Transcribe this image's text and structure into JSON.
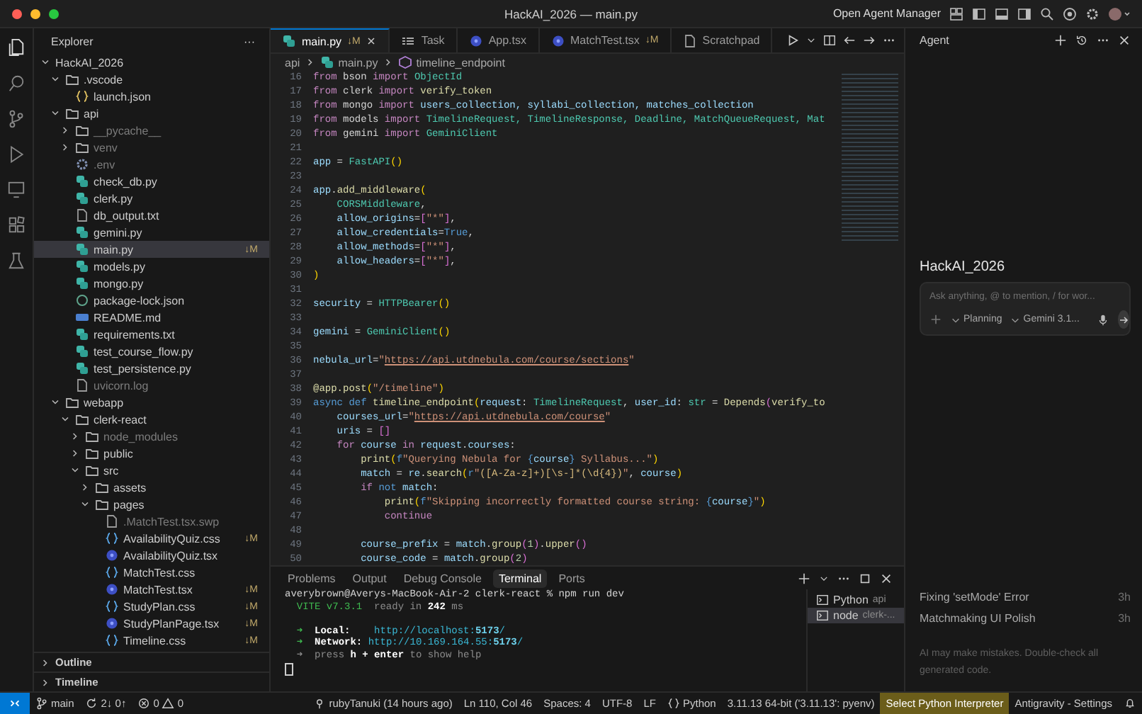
{
  "window": {
    "title": "HackAI_2026 — main.py",
    "agent_manager": "Open Agent Manager"
  },
  "explorer": {
    "title": "Explorer",
    "more": "···",
    "tree": [
      {
        "name": "HackAI_2026",
        "kind": "root",
        "expanded": true,
        "selected": false,
        "dimmed": false,
        "children": [
          {
            "name": ".vscode",
            "kind": "folder",
            "expanded": true,
            "selected": false,
            "dimmed": false,
            "children": [
              {
                "name": "launch.json",
                "kind": "json",
                "selected": false,
                "dimmed": false
              }
            ]
          },
          {
            "name": "api",
            "kind": "folder",
            "expanded": true,
            "selected": false,
            "dimmed": false,
            "children": [
              {
                "name": "__pycache__",
                "kind": "folder",
                "expanded": false,
                "selected": false,
                "dimmed": true
              },
              {
                "name": "venv",
                "kind": "folder",
                "expanded": false,
                "selected": false,
                "dimmed": true
              },
              {
                "name": ".env",
                "kind": "env",
                "selected": false,
                "dimmed": true
              },
              {
                "name": "check_db.py",
                "kind": "py",
                "selected": false,
                "dimmed": false
              },
              {
                "name": "clerk.py",
                "kind": "py",
                "selected": false,
                "dimmed": false
              },
              {
                "name": "db_output.txt",
                "kind": "txt",
                "selected": false,
                "dimmed": false
              },
              {
                "name": "gemini.py",
                "kind": "py",
                "selected": false,
                "dimmed": false
              },
              {
                "name": "main.py",
                "kind": "py",
                "selected": true,
                "dimmed": false,
                "badge": "↓M"
              },
              {
                "name": "models.py",
                "kind": "py",
                "selected": false,
                "dimmed": false
              },
              {
                "name": "mongo.py",
                "kind": "py",
                "selected": false,
                "dimmed": false
              },
              {
                "name": "package-lock.json",
                "kind": "npm",
                "selected": false,
                "dimmed": false
              },
              {
                "name": "README.md",
                "kind": "md",
                "selected": false,
                "dimmed": false
              },
              {
                "name": "requirements.txt",
                "kind": "py",
                "selected": false,
                "dimmed": false
              },
              {
                "name": "test_course_flow.py",
                "kind": "py",
                "selected": false,
                "dimmed": false
              },
              {
                "name": "test_persistence.py",
                "kind": "py",
                "selected": false,
                "dimmed": false
              },
              {
                "name": "uvicorn.log",
                "kind": "txt",
                "selected": false,
                "dimmed": true
              }
            ]
          },
          {
            "name": "webapp",
            "kind": "folder",
            "expanded": true,
            "selected": false,
            "dimmed": false,
            "children": [
              {
                "name": "clerk-react",
                "kind": "folder",
                "expanded": true,
                "selected": false,
                "dimmed": false,
                "children": [
                  {
                    "name": "node_modules",
                    "kind": "folder",
                    "expanded": false,
                    "selected": false,
                    "dimmed": true
                  },
                  {
                    "name": "public",
                    "kind": "folder",
                    "expanded": false,
                    "selected": false,
                    "dimmed": false
                  },
                  {
                    "name": "src",
                    "kind": "folder",
                    "expanded": true,
                    "selected": false,
                    "dimmed": false,
                    "children": [
                      {
                        "name": "assets",
                        "kind": "folder",
                        "expanded": false,
                        "selected": false,
                        "dimmed": false
                      },
                      {
                        "name": "pages",
                        "kind": "folder",
                        "expanded": true,
                        "selected": false,
                        "dimmed": false,
                        "children": [
                          {
                            "name": ".MatchTest.tsx.swp",
                            "kind": "txt",
                            "selected": false,
                            "dimmed": true
                          },
                          {
                            "name": "AvailabilityQuiz.css",
                            "kind": "css",
                            "selected": false,
                            "dimmed": false,
                            "badge": "↓M"
                          },
                          {
                            "name": "AvailabilityQuiz.tsx",
                            "kind": "react",
                            "selected": false,
                            "dimmed": false
                          },
                          {
                            "name": "MatchTest.css",
                            "kind": "css",
                            "selected": false,
                            "dimmed": false
                          },
                          {
                            "name": "MatchTest.tsx",
                            "kind": "react",
                            "selected": false,
                            "dimmed": false,
                            "badge": "↓M"
                          },
                          {
                            "name": "StudyPlan.css",
                            "kind": "css",
                            "selected": false,
                            "dimmed": false,
                            "badge": "↓M"
                          },
                          {
                            "name": "StudyPlanPage.tsx",
                            "kind": "react",
                            "selected": false,
                            "dimmed": false,
                            "badge": "↓M"
                          },
                          {
                            "name": "Timeline.css",
                            "kind": "css",
                            "selected": false,
                            "dimmed": false,
                            "badge": "↓M"
                          }
                        ]
                      }
                    ]
                  }
                ]
              }
            ]
          }
        ]
      }
    ],
    "sections": [
      {
        "label": "Outline",
        "expanded": false
      },
      {
        "label": "Timeline",
        "expanded": false
      }
    ]
  },
  "editor": {
    "tabs": [
      {
        "label": "main.py",
        "kind": "py",
        "selected": true,
        "badge": "↓M"
      },
      {
        "label": "Task",
        "kind": "task",
        "selected": false
      },
      {
        "label": "App.tsx",
        "kind": "react",
        "selected": false
      },
      {
        "label": "MatchTest.tsx",
        "kind": "react",
        "selected": false,
        "badge": "↓M"
      },
      {
        "label": "Scratchpad",
        "kind": "txt",
        "selected": false
      }
    ],
    "breadcrumb": [
      {
        "label": "api",
        "kind": "folder"
      },
      {
        "label": "main.py",
        "kind": "py"
      },
      {
        "label": "timeline_endpoint",
        "kind": "symbol"
      }
    ],
    "lines": [
      {
        "number": "16",
        "tokens": [
          {
            "kind": "kw",
            "text": "from"
          },
          {
            "kind": "pl",
            "text": " bson "
          },
          {
            "kind": "kw",
            "text": "import"
          },
          {
            "kind": "cls",
            "text": " ObjectId"
          }
        ]
      },
      {
        "number": "17",
        "tokens": [
          {
            "kind": "kw",
            "text": "from"
          },
          {
            "kind": "pl",
            "text": " clerk "
          },
          {
            "kind": "kw",
            "text": "import"
          },
          {
            "kind": "fn",
            "text": " verify_token"
          }
        ]
      },
      {
        "number": "18",
        "tokens": [
          {
            "kind": "kw",
            "text": "from"
          },
          {
            "kind": "pl",
            "text": " mongo "
          },
          {
            "kind": "kw",
            "text": "import"
          },
          {
            "kind": "var",
            "text": " users_collection, syllabi_collection, matches_collection"
          }
        ]
      },
      {
        "number": "19",
        "tokens": [
          {
            "kind": "kw",
            "text": "from"
          },
          {
            "kind": "pl",
            "text": " models "
          },
          {
            "kind": "kw",
            "text": "import"
          },
          {
            "kind": "cls",
            "text": " TimelineRequest, TimelineResponse, Deadline, MatchQueueRequest, Mat"
          }
        ]
      },
      {
        "number": "20",
        "tokens": [
          {
            "kind": "kw",
            "text": "from"
          },
          {
            "kind": "pl",
            "text": " gemini "
          },
          {
            "kind": "kw",
            "text": "import"
          },
          {
            "kind": "cls",
            "text": " GeminiClient"
          }
        ]
      },
      {
        "number": "21"
      },
      {
        "number": "22",
        "tokens": [
          {
            "kind": "var",
            "text": "app"
          },
          {
            "kind": "pl",
            "text": " = "
          },
          {
            "kind": "cls",
            "text": "FastAPI"
          },
          {
            "kind": "br",
            "text": "()"
          }
        ]
      },
      {
        "number": "23"
      },
      {
        "number": "24",
        "tokens": [
          {
            "kind": "var",
            "text": "app"
          },
          {
            "kind": "pl",
            "text": "."
          },
          {
            "kind": "fn",
            "text": "add_middleware"
          },
          {
            "kind": "br",
            "text": "("
          }
        ]
      },
      {
        "number": "25",
        "tokens": [
          {
            "kind": "cls",
            "text": "    CORSMiddleware"
          },
          {
            "kind": "pl",
            "text": ","
          }
        ]
      },
      {
        "number": "26",
        "tokens": [
          {
            "kind": "var",
            "text": "    allow_origins"
          },
          {
            "kind": "pl",
            "text": "="
          },
          {
            "kind": "br2",
            "text": "["
          },
          {
            "kind": "str",
            "text": "\"*\""
          },
          {
            "kind": "br2",
            "text": "]"
          },
          {
            "kind": "pl",
            "text": ","
          }
        ]
      },
      {
        "number": "27",
        "tokens": [
          {
            "kind": "var",
            "text": "    allow_credentials"
          },
          {
            "kind": "pl",
            "text": "="
          },
          {
            "kind": "st",
            "text": "True"
          },
          {
            "kind": "pl",
            "text": ","
          }
        ]
      },
      {
        "number": "28",
        "tokens": [
          {
            "kind": "var",
            "text": "    allow_methods"
          },
          {
            "kind": "pl",
            "text": "="
          },
          {
            "kind": "br2",
            "text": "["
          },
          {
            "kind": "str",
            "text": "\"*\""
          },
          {
            "kind": "br2",
            "text": "]"
          },
          {
            "kind": "pl",
            "text": ","
          }
        ]
      },
      {
        "number": "29",
        "tokens": [
          {
            "kind": "var",
            "text": "    allow_headers"
          },
          {
            "kind": "pl",
            "text": "="
          },
          {
            "kind": "br2",
            "text": "["
          },
          {
            "kind": "str",
            "text": "\"*\""
          },
          {
            "kind": "br2",
            "text": "]"
          },
          {
            "kind": "pl",
            "text": ","
          }
        ]
      },
      {
        "number": "30",
        "tokens": [
          {
            "kind": "br",
            "text": ")"
          }
        ]
      },
      {
        "number": "31"
      },
      {
        "number": "32",
        "tokens": [
          {
            "kind": "var",
            "text": "security"
          },
          {
            "kind": "pl",
            "text": " = "
          },
          {
            "kind": "cls",
            "text": "HTTPBearer"
          },
          {
            "kind": "br",
            "text": "()"
          }
        ]
      },
      {
        "number": "33"
      },
      {
        "number": "34",
        "tokens": [
          {
            "kind": "var",
            "text": "gemini"
          },
          {
            "kind": "pl",
            "text": " = "
          },
          {
            "kind": "cls",
            "text": "GeminiClient"
          },
          {
            "kind": "br",
            "text": "()"
          }
        ]
      },
      {
        "number": "35"
      },
      {
        "number": "36",
        "tokens": [
          {
            "kind": "var",
            "text": "nebula_url"
          },
          {
            "kind": "pl",
            "text": "="
          },
          {
            "kind": "str",
            "text": "\""
          },
          {
            "kind": "url",
            "text": "https://api.utdnebula.com/course/sections"
          },
          {
            "kind": "str",
            "text": "\""
          }
        ]
      },
      {
        "number": "37"
      },
      {
        "number": "38",
        "tokens": [
          {
            "kind": "fn",
            "text": "@app.post"
          },
          {
            "kind": "br",
            "text": "("
          },
          {
            "kind": "str",
            "text": "\"/timeline\""
          },
          {
            "kind": "br",
            "text": ")"
          }
        ]
      },
      {
        "number": "39",
        "tokens": [
          {
            "kind": "st",
            "text": "async def "
          },
          {
            "kind": "fn",
            "text": "timeline_endpoint"
          },
          {
            "kind": "br",
            "text": "("
          },
          {
            "kind": "var",
            "text": "request"
          },
          {
            "kind": "pl",
            "text": ": "
          },
          {
            "kind": "cls",
            "text": "TimelineRequest"
          },
          {
            "kind": "pl",
            "text": ", "
          },
          {
            "kind": "var",
            "text": "user_id"
          },
          {
            "kind": "pl",
            "text": ": "
          },
          {
            "kind": "cls",
            "text": "str"
          },
          {
            "kind": "pl",
            "text": " = "
          },
          {
            "kind": "fn",
            "text": "Depends"
          },
          {
            "kind": "br2",
            "text": "("
          },
          {
            "kind": "fn",
            "text": "verify_to"
          }
        ]
      },
      {
        "number": "40",
        "tokens": [
          {
            "kind": "var",
            "text": "    courses_url"
          },
          {
            "kind": "pl",
            "text": "="
          },
          {
            "kind": "str",
            "text": "\""
          },
          {
            "kind": "url",
            "text": "https://api.utdnebula.com/course"
          },
          {
            "kind": "str",
            "text": "\""
          }
        ]
      },
      {
        "number": "41",
        "tokens": [
          {
            "kind": "var",
            "text": "    uris"
          },
          {
            "kind": "pl",
            "text": " = "
          },
          {
            "kind": "br2",
            "text": "[]"
          }
        ]
      },
      {
        "number": "42",
        "tokens": [
          {
            "kind": "kw",
            "text": "    for "
          },
          {
            "kind": "var",
            "text": "course "
          },
          {
            "kind": "kw",
            "text": "in "
          },
          {
            "kind": "var",
            "text": "request"
          },
          {
            "kind": "pl",
            "text": "."
          },
          {
            "kind": "var",
            "text": "courses"
          },
          {
            "kind": "pl",
            "text": ":"
          }
        ]
      },
      {
        "number": "43",
        "tokens": [
          {
            "kind": "fn",
            "text": "        print"
          },
          {
            "kind": "br",
            "text": "("
          },
          {
            "kind": "st",
            "text": "f"
          },
          {
            "kind": "str",
            "text": "\"Querying Nebula for "
          },
          {
            "kind": "st",
            "text": "{"
          },
          {
            "kind": "var",
            "text": "course"
          },
          {
            "kind": "st",
            "text": "}"
          },
          {
            "kind": "str",
            "text": " Syllabus...\""
          },
          {
            "kind": "br",
            "text": ")"
          }
        ]
      },
      {
        "number": "44",
        "tokens": [
          {
            "kind": "var",
            "text": "        match"
          },
          {
            "kind": "pl",
            "text": " = "
          },
          {
            "kind": "var",
            "text": "re"
          },
          {
            "kind": "pl",
            "text": "."
          },
          {
            "kind": "fn",
            "text": "search"
          },
          {
            "kind": "br",
            "text": "("
          },
          {
            "kind": "st",
            "text": "r"
          },
          {
            "kind": "str",
            "text": "\""
          },
          {
            "kind": "esc",
            "text": "([A-Za-z]+)[\\s-]*(\\d{4})"
          },
          {
            "kind": "str",
            "text": "\""
          },
          {
            "kind": "pl",
            "text": ", "
          },
          {
            "kind": "var",
            "text": "course"
          },
          {
            "kind": "br",
            "text": ")"
          }
        ]
      },
      {
        "number": "45",
        "tokens": [
          {
            "kind": "kw",
            "text": "        if "
          },
          {
            "kind": "st",
            "text": "not "
          },
          {
            "kind": "var",
            "text": "match"
          },
          {
            "kind": "pl",
            "text": ":"
          }
        ]
      },
      {
        "number": "46",
        "tokens": [
          {
            "kind": "fn",
            "text": "            print"
          },
          {
            "kind": "br",
            "text": "("
          },
          {
            "kind": "st",
            "text": "f"
          },
          {
            "kind": "str",
            "text": "\"Skipping incorrectly formatted course string: "
          },
          {
            "kind": "st",
            "text": "{"
          },
          {
            "kind": "var",
            "text": "course"
          },
          {
            "kind": "st",
            "text": "}"
          },
          {
            "kind": "str",
            "text": "\""
          },
          {
            "kind": "br",
            "text": ")"
          }
        ]
      },
      {
        "number": "47",
        "tokens": [
          {
            "kind": "kw",
            "text": "            continue"
          }
        ]
      },
      {
        "number": "48"
      },
      {
        "number": "49",
        "tokens": [
          {
            "kind": "var",
            "text": "        course_prefix"
          },
          {
            "kind": "pl",
            "text": " = "
          },
          {
            "kind": "var",
            "text": "match"
          },
          {
            "kind": "pl",
            "text": "."
          },
          {
            "kind": "fn",
            "text": "group"
          },
          {
            "kind": "br2",
            "text": "("
          },
          {
            "kind": "num",
            "text": "1"
          },
          {
            "kind": "br2",
            "text": ")"
          },
          {
            "kind": "pl",
            "text": "."
          },
          {
            "kind": "fn",
            "text": "upper"
          },
          {
            "kind": "br2",
            "text": "()"
          }
        ]
      },
      {
        "number": "50",
        "tokens": [
          {
            "kind": "var",
            "text": "        course_code"
          },
          {
            "kind": "pl",
            "text": " = "
          },
          {
            "kind": "var",
            "text": "match"
          },
          {
            "kind": "pl",
            "text": "."
          },
          {
            "kind": "fn",
            "text": "group"
          },
          {
            "kind": "br2",
            "text": "("
          },
          {
            "kind": "num",
            "text": "2"
          },
          {
            "kind": "br2",
            "text": ")"
          }
        ]
      }
    ]
  },
  "panel": {
    "tabs": [
      {
        "label": "Problems",
        "selected": false
      },
      {
        "label": "Output",
        "selected": false
      },
      {
        "label": "Debug Console",
        "selected": false
      },
      {
        "label": "Terminal",
        "selected": true
      },
      {
        "label": "Ports",
        "selected": false
      }
    ],
    "terminal_lines": [
      {
        "tokens": [
          {
            "kind": "pl",
            "text": "averybrown@Averys-MacBook-Air-2 clerk-react % npm run dev"
          }
        ]
      },
      {
        "tokens": [
          {
            "kind": "grn",
            "text": "  VITE v7.3.1"
          },
          {
            "kind": "dim",
            "text": "  ready in "
          },
          {
            "kind": "bold",
            "text": "242"
          },
          {
            "kind": "dim",
            "text": " ms"
          }
        ]
      },
      {
        "tokens": [
          {
            "kind": "grn",
            "text": "  ➜"
          },
          {
            "kind": "bold",
            "text": "  Local:    "
          },
          {
            "kind": "cyan",
            "text": "http://localhost:"
          },
          {
            "kind": "cyanb",
            "text": "5173"
          },
          {
            "kind": "cyan",
            "text": "/"
          }
        ]
      },
      {
        "tokens": [
          {
            "kind": "grn",
            "text": "  ➜"
          },
          {
            "kind": "bold",
            "text": "  Network: "
          },
          {
            "kind": "cyan",
            "text": "http://10.169.164.55:"
          },
          {
            "kind": "cyanb",
            "text": "5173"
          },
          {
            "kind": "cyan",
            "text": "/"
          }
        ]
      },
      {
        "tokens": [
          {
            "kind": "dim",
            "text": "  ➜  press "
          },
          {
            "kind": "bold",
            "text": "h + enter"
          },
          {
            "kind": "dim",
            "text": " to show help"
          }
        ]
      }
    ],
    "terminals": [
      {
        "name": "Python",
        "folder": "api",
        "selected": false
      },
      {
        "name": "node",
        "folder": "clerk-...",
        "selected": true
      }
    ]
  },
  "agent": {
    "title": "Agent",
    "workspace": "HackAI_2026",
    "input": {
      "placeholder": "Ask anything, @ to mention, / for wor..."
    },
    "mode": "Planning",
    "model": "Gemini 3.1...",
    "conversations": [
      {
        "title": "Fixing 'setMode' Error",
        "age": "3h"
      },
      {
        "title": "Matchmaking UI Polish",
        "age": "3h"
      }
    ],
    "note": "AI may make mistakes. Double-check all generated code."
  },
  "status_bar": {
    "left": [
      {
        "kind": "remote"
      },
      {
        "kind": "branch",
        "text": "main"
      },
      {
        "kind": "sync",
        "text": "2↓ 0↑"
      },
      {
        "kind": "problems",
        "errors": "0",
        "warnings": "0"
      }
    ],
    "right": [
      {
        "kind": "blame",
        "text": "rubyTanuki (14 hours ago)"
      },
      {
        "kind": "plain",
        "text": "Ln 110, Col 46"
      },
      {
        "kind": "plain",
        "text": "Spaces: 4"
      },
      {
        "kind": "plain",
        "text": "UTF-8"
      },
      {
        "kind": "plain",
        "text": "LF"
      },
      {
        "kind": "language",
        "text": "Python"
      },
      {
        "kind": "plain",
        "text": "3.11.13 64-bit ('3.11.13': pyenv)"
      },
      {
        "kind": "highlight",
        "text": "Select Python Interpreter"
      },
      {
        "kind": "plain",
        "text": "Antigravity - Settings"
      },
      {
        "kind": "bell"
      }
    ]
  }
}
